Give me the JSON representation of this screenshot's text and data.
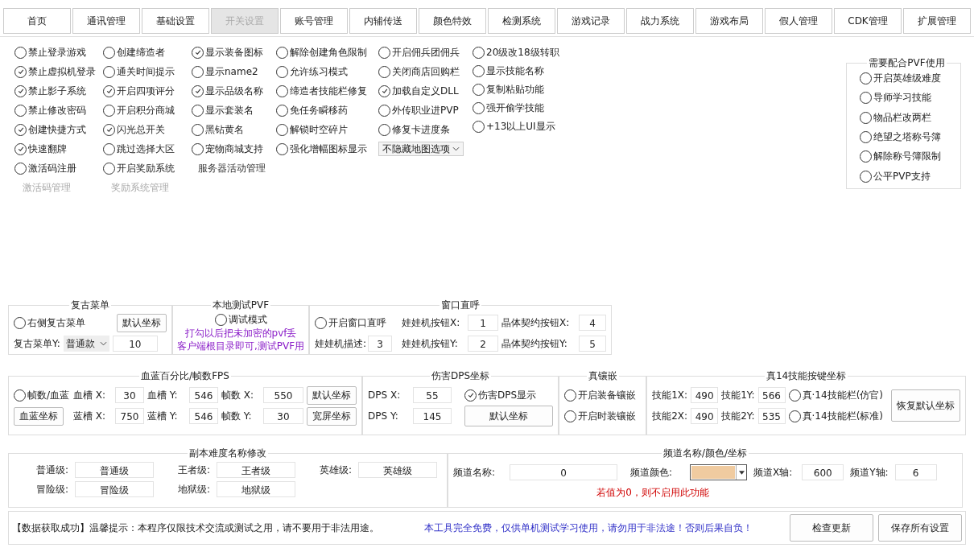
{
  "tabs": [
    {
      "label": "首页",
      "selected": false
    },
    {
      "label": "通讯管理",
      "selected": false
    },
    {
      "label": "基础设置",
      "selected": false
    },
    {
      "label": "开关设置",
      "selected": true
    },
    {
      "label": "账号管理",
      "selected": false
    },
    {
      "label": "内辅传送",
      "selected": false
    },
    {
      "label": "颜色特效",
      "selected": false
    },
    {
      "label": "检测系统",
      "selected": false
    },
    {
      "label": "游戏记录",
      "selected": false
    },
    {
      "label": "战力系统",
      "selected": false
    },
    {
      "label": "游戏布局",
      "selected": false
    },
    {
      "label": "假人管理",
      "selected": false
    },
    {
      "label": "CDK管理",
      "selected": false
    },
    {
      "label": "扩展管理",
      "selected": false
    }
  ],
  "option_columns": [
    {
      "items": [
        {
          "kind": "check",
          "label": "禁止登录游戏",
          "checked": false
        },
        {
          "kind": "check",
          "label": "禁止虚拟机登录",
          "checked": true
        },
        {
          "kind": "check",
          "label": "禁止影子系统",
          "checked": true
        },
        {
          "kind": "check",
          "label": "禁止修改密码",
          "checked": false
        },
        {
          "kind": "check",
          "label": "创建快捷方式",
          "checked": true
        },
        {
          "kind": "check",
          "label": "快速翻牌",
          "checked": true
        },
        {
          "kind": "check",
          "label": "激活码注册",
          "checked": false
        },
        {
          "kind": "label",
          "label": "激活码管理",
          "disabled": true
        }
      ]
    },
    {
      "items": [
        {
          "kind": "check",
          "label": "创建缔造者",
          "checked": false
        },
        {
          "kind": "check",
          "label": "通关时间提示",
          "checked": false
        },
        {
          "kind": "check",
          "label": "开启四项评分",
          "checked": true
        },
        {
          "kind": "check",
          "label": "开启积分商城",
          "checked": false
        },
        {
          "kind": "check",
          "label": "闪光总开关",
          "checked": true
        },
        {
          "kind": "check",
          "label": "跳过选择大区",
          "checked": false
        },
        {
          "kind": "check",
          "label": "开启奖励系统",
          "checked": false
        },
        {
          "kind": "label",
          "label": "奖励系统管理",
          "disabled": true
        }
      ]
    },
    {
      "items": [
        {
          "kind": "check",
          "label": "显示装备图标",
          "checked": true
        },
        {
          "kind": "check",
          "label": "显示name2",
          "checked": false
        },
        {
          "kind": "check",
          "label": "显示品级名称",
          "checked": true
        },
        {
          "kind": "check",
          "label": "显示套装名",
          "checked": false
        },
        {
          "kind": "check",
          "label": "黑钻黄名",
          "checked": false
        },
        {
          "kind": "check",
          "label": "宠物商城支持",
          "checked": false
        },
        {
          "kind": "label",
          "label": "服务器活动管理",
          "disabled": false
        }
      ]
    },
    {
      "items": [
        {
          "kind": "check",
          "label": "解除创建角色限制",
          "checked": false
        },
        {
          "kind": "check",
          "label": "允许练习模式",
          "checked": false
        },
        {
          "kind": "check",
          "label": "缔造者技能栏修复",
          "checked": false
        },
        {
          "kind": "check",
          "label": "免任务瞬移药",
          "checked": false
        },
        {
          "kind": "check",
          "label": "解锁时空碎片",
          "checked": false
        },
        {
          "kind": "check",
          "label": "强化增幅图标显示",
          "checked": false
        }
      ]
    },
    {
      "items": [
        {
          "kind": "check",
          "label": "开启佣兵团佣兵",
          "checked": false
        },
        {
          "kind": "check",
          "label": "关闭商店回购栏",
          "checked": false
        },
        {
          "kind": "check",
          "label": "加载自定义DLL",
          "checked": true
        },
        {
          "kind": "check",
          "label": "外传职业进PVP",
          "checked": false
        },
        {
          "kind": "check",
          "label": "修复卡进度条",
          "checked": false
        },
        {
          "kind": "select",
          "label": "不隐藏地图选项"
        }
      ]
    },
    {
      "items": [
        {
          "kind": "check",
          "label": "20级改18级转职",
          "checked": false
        },
        {
          "kind": "check",
          "label": "显示技能名称",
          "checked": false
        },
        {
          "kind": "check",
          "label": "复制粘贴功能",
          "checked": false
        },
        {
          "kind": "check",
          "label": "强开偷学技能",
          "checked": false
        },
        {
          "kind": "check",
          "label": "+13以上UI显示",
          "checked": false
        }
      ]
    }
  ],
  "pvf_group": {
    "title": "需要配合PVF使用",
    "items": [
      {
        "label": "开启英雄级难度",
        "checked": false
      },
      {
        "label": "导师学习技能",
        "checked": false
      },
      {
        "label": "物品栏改两栏",
        "checked": false
      },
      {
        "label": "绝望之塔称号簿",
        "checked": false
      },
      {
        "label": "解除称号簿限制",
        "checked": false
      },
      {
        "label": "公平PVP支持",
        "checked": false
      }
    ]
  },
  "retro_menu": {
    "title": "复古菜单",
    "option": {
      "label": "右侧复古菜单",
      "checked": false
    },
    "button": "默认坐标",
    "field_label": "复古菜单Y:",
    "select_value": "普通款",
    "value": "10"
  },
  "local_pvf": {
    "title": "本地测试PVF",
    "option": {
      "label": "调试模式",
      "checked": false
    },
    "note_lines": [
      "打勾以后把未加密的pvf丢",
      "客户端根目录即可,测试PVF用"
    ]
  },
  "window_call": {
    "title": "窗口直呼",
    "option": {
      "label": "开启窗口直呼",
      "checked": false
    },
    "fields": [
      {
        "label": "娃娃机按钮X:",
        "value": "1"
      },
      {
        "label": "晶体契约按钮X:",
        "value": "4"
      },
      {
        "label": "娃娃机描述:",
        "value": "3"
      },
      {
        "label": "娃娃机按钮Y:",
        "value": "2"
      },
      {
        "label": "晶体契约按钮Y:",
        "value": "5"
      }
    ]
  },
  "hp_mp": {
    "title": "血蓝百分比/帧数FPS",
    "rows": [
      {
        "lead": {
          "kind": "check",
          "label": "帧数/血蓝",
          "checked": false
        },
        "fields": [
          {
            "label": "血槽 X:",
            "value": "30"
          },
          {
            "label": "血槽 Y:",
            "value": "546"
          },
          {
            "label": "帧数 X:",
            "value": "550"
          }
        ],
        "button": "默认坐标"
      },
      {
        "lead": {
          "kind": "button",
          "label": "血蓝坐标"
        },
        "fields": [
          {
            "label": "蓝槽 X:",
            "value": "750"
          },
          {
            "label": "蓝槽 Y:",
            "value": "546"
          },
          {
            "label": "帧数 Y:",
            "value": "30"
          }
        ],
        "button": "宽屏坐标"
      }
    ]
  },
  "dps": {
    "title": "伤害DPS坐标",
    "rows": [
      {
        "field": {
          "label": "DPS X:",
          "value": "55"
        },
        "trail": {
          "kind": "check",
          "label": "伤害DPS显示",
          "checked": true
        }
      },
      {
        "field": {
          "label": "DPS Y:",
          "value": "145"
        },
        "trail": {
          "kind": "button",
          "label": "默认坐标"
        }
      }
    ]
  },
  "inlay": {
    "title": "真镶嵌",
    "items": [
      {
        "label": "开启装备镶嵌",
        "checked": false
      },
      {
        "label": "开启时装镶嵌",
        "checked": false
      }
    ]
  },
  "skill14": {
    "title": "真14技能按键坐标",
    "rows": [
      {
        "fields": [
          {
            "label": "技能1X:",
            "value": "490"
          },
          {
            "label": "技能1Y:",
            "value": "566"
          }
        ],
        "option": {
          "label": "真·14技能栏(仿官)",
          "checked": false
        }
      },
      {
        "fields": [
          {
            "label": "技能2X:",
            "value": "490"
          },
          {
            "label": "技能2Y:",
            "value": "535"
          }
        ],
        "option": {
          "label": "真·14技能栏(标准)",
          "checked": false
        }
      }
    ],
    "button": "恢复默认坐标"
  },
  "dungeon": {
    "title": "副本难度名称修改",
    "fields": [
      {
        "label": "普通级:",
        "value": "普通级"
      },
      {
        "label": "王者级:",
        "value": "王者级"
      },
      {
        "label": "英雄级:",
        "value": "英雄级"
      },
      {
        "label": "冒险级:",
        "value": "冒险级"
      },
      {
        "label": "地狱级:",
        "value": "地狱级"
      }
    ]
  },
  "channel": {
    "title": "频道名称/颜色/坐标",
    "name_label": "频道名称:",
    "name_value": "0",
    "color_label": "频道颜色:",
    "color": "#f0cba0",
    "x_label": "频道X轴:",
    "x_value": "600",
    "y_label": "频道Y轴:",
    "y_value": "6",
    "note": "若值为0，则不启用此功能"
  },
  "status": {
    "message": "【数据获取成功】温馨提示：本程序仅限技术交流或测试之用，请不要用于非法用途。",
    "notice": "本工具完全免费，仅供单机测试学习使用，请勿用于非法途！否则后果自负！",
    "buttons": [
      "检查更新",
      "保存所有设置"
    ]
  }
}
